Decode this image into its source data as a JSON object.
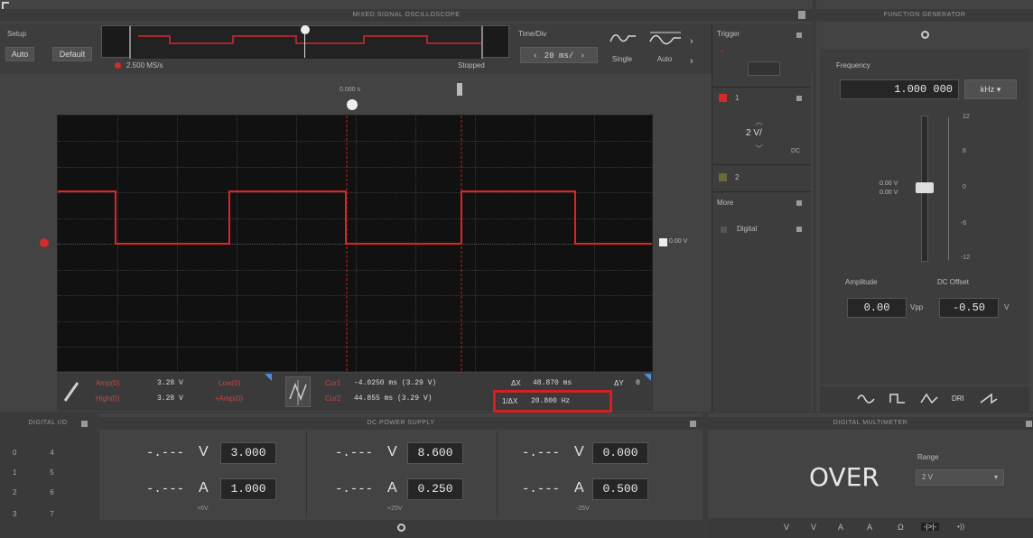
{
  "scope": {
    "title": "MIXED SIGNAL OSCILLOSCOPE",
    "setup_label": "Setup",
    "auto_label": "Auto",
    "default_label": "Default",
    "sample_rate": "2.500 MS/s",
    "status": "Stopped",
    "timediv_label": "Time/Div",
    "timediv_value": "20 ms/",
    "single_label": "Single",
    "auto_mode_label": "Auto",
    "trigger_label": "Trigger",
    "ch1_label": "1",
    "ch1_scale": "2 V/",
    "ch1_coupling": "DC",
    "ch2_label": "2",
    "more_label": "More",
    "digital_label": "Digital",
    "trace_level_label": "0.00 V",
    "cursor_a_label": "0.000 s",
    "measurements": {
      "amp_label": "Amp(0)",
      "amp_value": "3.28 V",
      "high_label": "High(0)",
      "high_value": "3.28 V",
      "low_label": "Low(0)",
      "amp2_label": "+Amp(0)",
      "cur1_label": "Cur1",
      "cur1_value": "-4.0250 ms (3.29 V)",
      "cur2_label": "Cur2",
      "cur2_value": "44.855 ms (3.29 V)",
      "dx_label": "ΔX",
      "dx_value": "48.870 ms",
      "inv_dx_label": "1/ΔX",
      "inv_dx_value": "20.800 Hz",
      "dy_label": "ΔY",
      "dy_value": "0"
    },
    "highlight_color": "#d62020",
    "trace_color": "#e02424"
  },
  "funcgen": {
    "title": "FUNCTION GENERATOR",
    "frequency_label": "Frequency",
    "frequency_value": "1.000 000",
    "frequency_unit": "kHz",
    "slider_ticks": [
      "12",
      "8",
      "0",
      "-6",
      "-12"
    ],
    "slider_readout_1": "0.00 V",
    "slider_readout_2": "0.00 V",
    "amplitude_label": "Amplitude",
    "amplitude_value": "0.00",
    "amplitude_unit": "Vpp",
    "offset_label": "DC Offset",
    "offset_value": "-0.50",
    "offset_unit": "V",
    "wave_buttons": [
      "sine",
      "square",
      "triangle",
      "DRI",
      "ramp"
    ]
  },
  "digital_io": {
    "title": "DIGITAL I/O",
    "rows": [
      [
        "0",
        "4"
      ],
      [
        "1",
        "5"
      ],
      [
        "2",
        "6"
      ],
      [
        "3",
        "7"
      ]
    ]
  },
  "dc_power": {
    "title": "DC POWER SUPPLY",
    "channels": [
      {
        "v_read": "-.---",
        "v_set": "3.000",
        "a_read": "-.---",
        "a_set": "1.000",
        "name": "+6V"
      },
      {
        "v_read": "-.---",
        "v_set": "8.600",
        "a_read": "-.---",
        "a_set": "0.250",
        "name": "+25V"
      },
      {
        "v_read": "-.---",
        "v_set": "0.000",
        "a_read": "-.---",
        "a_set": "0.500",
        "name": "-25V"
      }
    ],
    "v_unit": "V",
    "a_unit": "A"
  },
  "dmm": {
    "title": "DIGITAL MULTIMETER",
    "reading": "OVER",
    "range_label": "Range",
    "range_value": "2 V",
    "modes": [
      "V",
      "V",
      "A",
      "A",
      "Ω",
      "-|>|-",
      "•))"
    ]
  }
}
